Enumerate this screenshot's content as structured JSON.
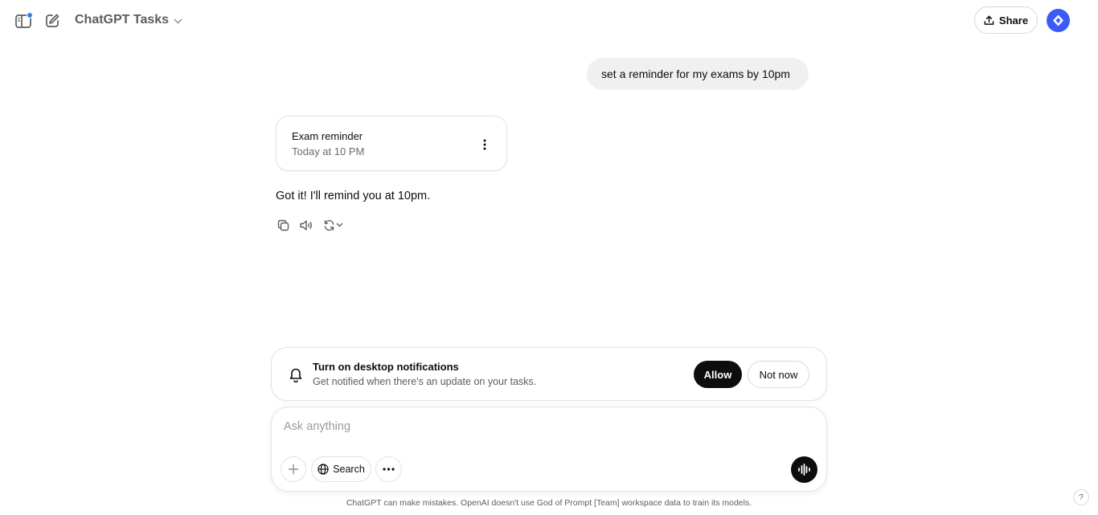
{
  "header": {
    "model_title": "ChatGPT Tasks",
    "share_label": "Share",
    "sidebar_notification_color": "#2f7ef7",
    "avatar_color": "#3b5bf5"
  },
  "conversation": {
    "user_message": "set a reminder for my exams by 10pm",
    "task_card": {
      "title": "Exam reminder",
      "time": "Today at 10 PM"
    },
    "assistant_message": "Got it! I'll remind you at 10pm."
  },
  "notification": {
    "title": "Turn on desktop notifications",
    "subtitle": "Get notified when there's an update on your tasks.",
    "allow_label": "Allow",
    "not_now_label": "Not now"
  },
  "composer": {
    "placeholder": "Ask anything",
    "search_label": "Search"
  },
  "footer": {
    "disclaimer": "ChatGPT can make mistakes. OpenAI doesn't use God of Prompt [Team] workspace data to train its models.",
    "help_label": "?"
  },
  "icons": {
    "sidebar": "sidebar-icon",
    "new_chat": "pencil-square-icon",
    "share": "upload-icon",
    "copy": "copy-icon",
    "read_aloud": "speaker-icon",
    "regenerate": "refresh-icon",
    "bell": "bell-icon",
    "plus": "plus-icon",
    "globe": "globe-icon",
    "more": "ellipsis-icon",
    "voice": "waveform-icon"
  }
}
